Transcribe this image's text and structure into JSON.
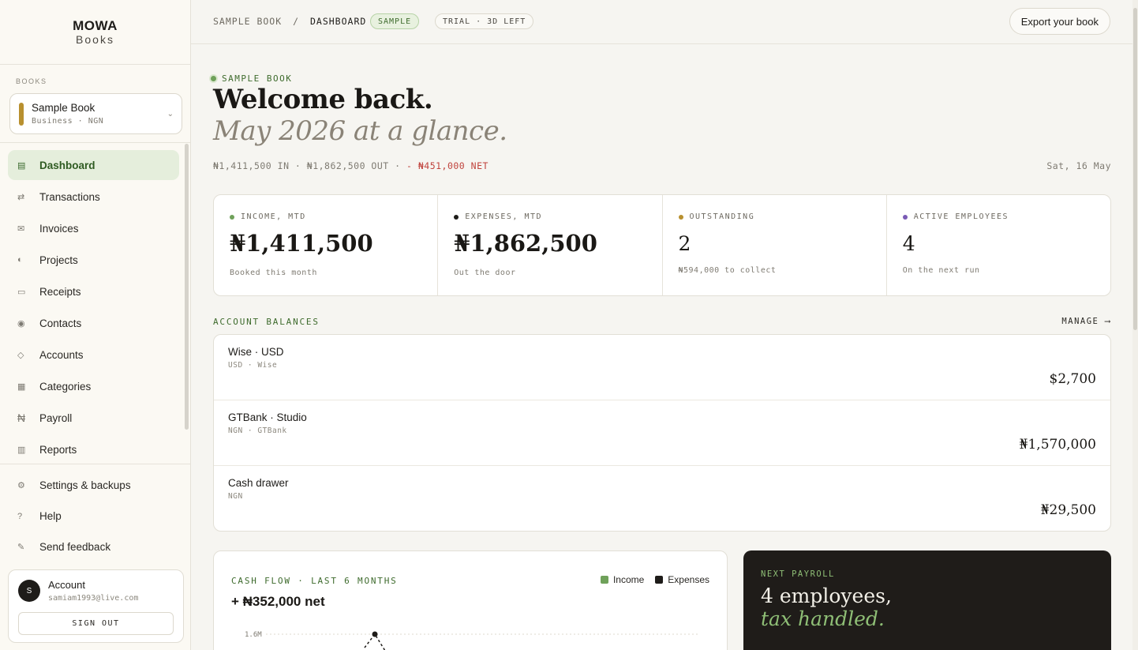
{
  "brand": {
    "name": "MOWA",
    "sub": "Books"
  },
  "sidebar": {
    "books_label": "BOOKS",
    "book": {
      "name": "Sample Book",
      "meta": "Business · NGN",
      "color": "#b8902f"
    },
    "items": [
      {
        "label": "Dashboard",
        "icon": "▤",
        "active": true
      },
      {
        "label": "Transactions",
        "icon": "⇄"
      },
      {
        "label": "Invoices",
        "icon": "✉"
      },
      {
        "label": "Projects",
        "icon": "◐"
      },
      {
        "label": "Receipts",
        "icon": "▭"
      },
      {
        "label": "Contacts",
        "icon": "◉"
      },
      {
        "label": "Accounts",
        "icon": "◇"
      },
      {
        "label": "Categories",
        "icon": "▦"
      },
      {
        "label": "Payroll",
        "icon": "₦"
      },
      {
        "label": "Reports",
        "icon": "▥"
      }
    ],
    "bottom_items": [
      {
        "label": "Settings & backups",
        "icon": "⚙"
      },
      {
        "label": "Help",
        "icon": "?"
      },
      {
        "label": "Send feedback",
        "icon": "✎"
      }
    ],
    "account": {
      "initial": "S",
      "name": "Account",
      "email": "samiam1993@live.com",
      "signout": "SIGN OUT"
    }
  },
  "topbar": {
    "crumb_book": "SAMPLE BOOK",
    "crumb_sep": "/",
    "crumb_page": "DASHBOARD",
    "sample_pill": "SAMPLE",
    "trial_pill": "TRIAL · 3D LEFT",
    "export_label": "Export your book"
  },
  "header": {
    "eyebrow": "SAMPLE BOOK",
    "title": "Welcome back.",
    "subtitle": "May 2026 at a glance.",
    "summary_in_out": "₦1,411,500 IN · ₦1,862,500 OUT ·",
    "summary_net": "- ₦451,000 NET",
    "date": "Sat, 16 May"
  },
  "stats": [
    {
      "label": "INCOME, MTD",
      "value": "₦1,411,500",
      "sub": "Booked this month",
      "dot": "#6fa15a"
    },
    {
      "label": "EXPENSES, MTD",
      "value": "₦1,862,500",
      "sub": "Out the door",
      "dot": "#1e1c19"
    },
    {
      "label": "OUTSTANDING",
      "value": "2",
      "sub": "₦594,000 to collect",
      "dot": "#b8902f"
    },
    {
      "label": "ACTIVE EMPLOYEES",
      "value": "4",
      "sub": "On the next run",
      "dot": "#7a5bb5"
    }
  ],
  "balances": {
    "label": "ACCOUNT BALANCES",
    "manage": "MANAGE ⟶",
    "rows": [
      {
        "name": "Wise · USD",
        "meta": "USD · Wise",
        "amount": "$2,700"
      },
      {
        "name": "GTBank · Studio",
        "meta": "NGN · GTBank",
        "amount": "₦1,570,000"
      },
      {
        "name": "Cash drawer",
        "meta": "NGN",
        "amount": "₦29,500"
      }
    ]
  },
  "cashflow": {
    "title": "CASH FLOW · LAST 6 MONTHS",
    "net": "+ ₦352,000 net",
    "legend_income": "Income",
    "legend_expenses": "Expenses",
    "income_color": "#6fa15a",
    "expenses_color": "#1e1c19",
    "ytick_top": "1.6M"
  },
  "payroll": {
    "label": "NEXT PAYROLL",
    "line1": "4 employees,",
    "line2": "tax handled."
  }
}
